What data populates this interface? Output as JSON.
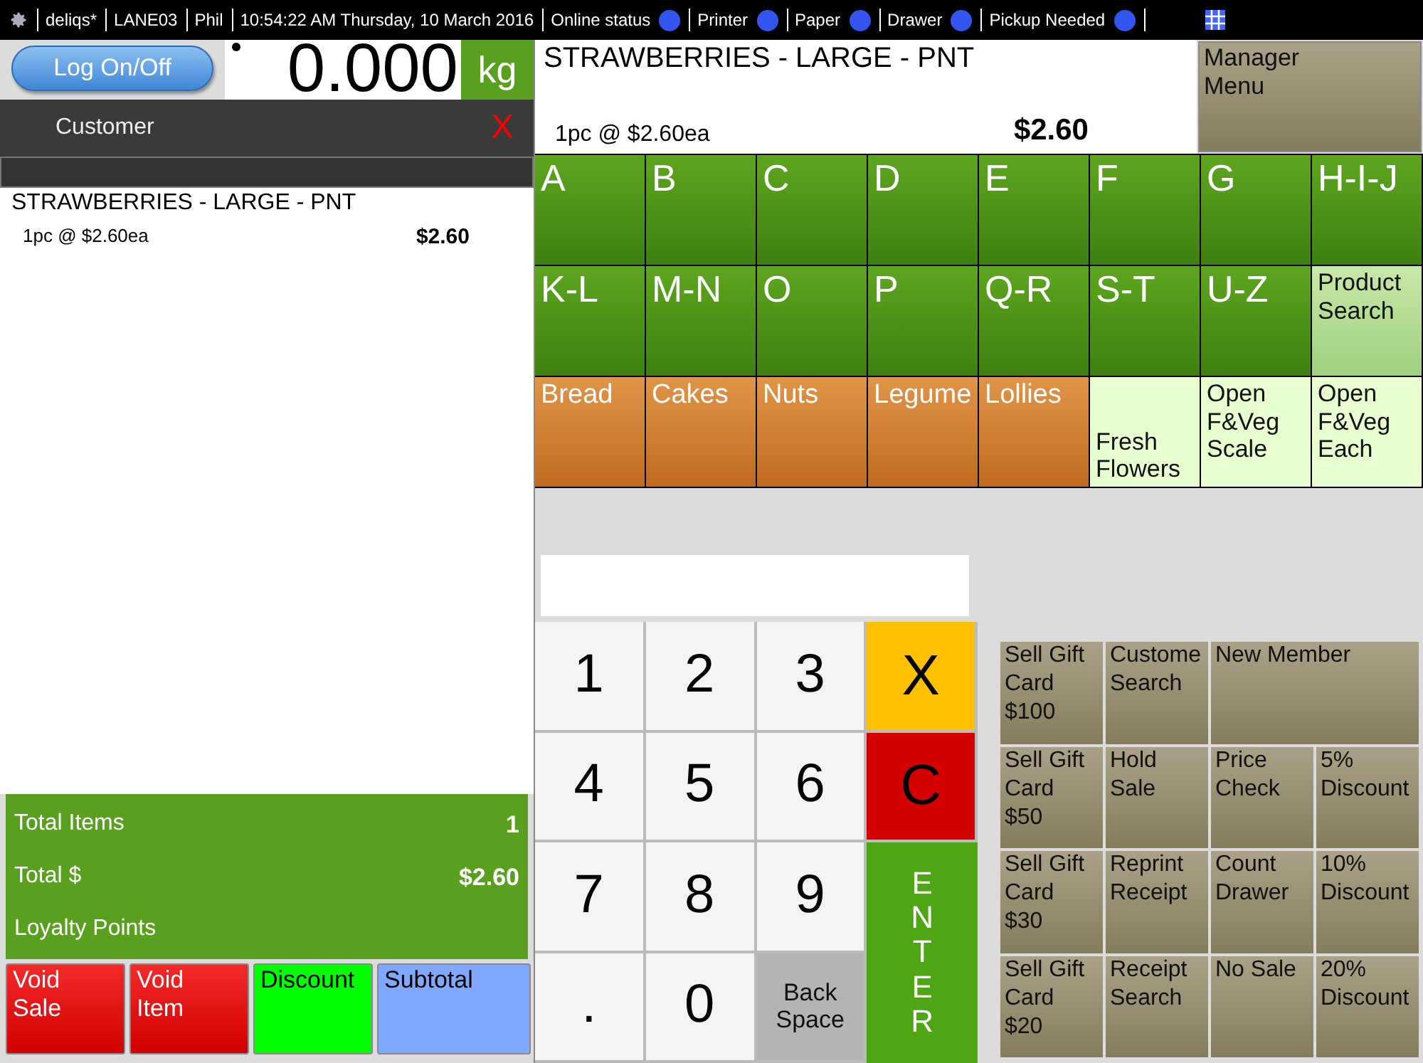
{
  "status_bar": {
    "items": [
      {
        "label": "deliqs*"
      },
      {
        "label": "LANE03"
      },
      {
        "label": "Phil"
      },
      {
        "label": "10:54:22 AM Thursday, 10 March 2016"
      }
    ],
    "indicators": [
      {
        "label": "Online status",
        "color": "#3355ee"
      },
      {
        "label": "Printer",
        "color": "#3355ee"
      },
      {
        "label": "Paper",
        "color": "#3355ee"
      },
      {
        "label": "Drawer",
        "color": "#3355ee"
      },
      {
        "label": "Pickup Needed",
        "color": "#3355ee"
      }
    ]
  },
  "login_button": "Log On/Off",
  "scale": {
    "value": "0.000",
    "unit": "kg"
  },
  "customer": {
    "label": "Customer",
    "clear": "X"
  },
  "sale_items": [
    {
      "name": "STRAWBERRIES - LARGE - PNT",
      "detail": "1pc @ $2.60ea",
      "price": "$2.60"
    }
  ],
  "totals": [
    {
      "label": "Total Items",
      "value": "1"
    },
    {
      "label": "Total $",
      "value": "$2.60"
    },
    {
      "label": "Loyalty Points"
    }
  ],
  "sale_actions": [
    {
      "label": "Void\nSale",
      "kind": "void"
    },
    {
      "label": "Void\nItem",
      "kind": "void"
    },
    {
      "label": "Discount",
      "kind": "discount"
    },
    {
      "label": "Subtotal",
      "kind": "subtotal"
    }
  ],
  "current_item": {
    "name": "STRAWBERRIES - LARGE - PNT",
    "detail": "1pc @ $2.60ea",
    "price": "$2.60"
  },
  "manager_menu": "Manager\nMenu",
  "categories": [
    {
      "label": "A",
      "kind": "letter"
    },
    {
      "label": "B",
      "kind": "letter"
    },
    {
      "label": "C",
      "kind": "letter"
    },
    {
      "label": "D",
      "kind": "letter"
    },
    {
      "label": "E",
      "kind": "letter"
    },
    {
      "label": "F",
      "kind": "letter"
    },
    {
      "label": "G",
      "kind": "letter"
    },
    {
      "label": "H-I-J",
      "kind": "letter"
    },
    {
      "label": "K-L",
      "kind": "letter"
    },
    {
      "label": "M-N",
      "kind": "letter"
    },
    {
      "label": "O",
      "kind": "letter"
    },
    {
      "label": "P",
      "kind": "letter"
    },
    {
      "label": "Q-R",
      "kind": "letter"
    },
    {
      "label": "S-T",
      "kind": "letter"
    },
    {
      "label": "U-Z",
      "kind": "letter"
    },
    {
      "label": "Product\nSearch",
      "kind": "search"
    },
    {
      "label": "Bread",
      "kind": "group"
    },
    {
      "label": "Cakes",
      "kind": "group"
    },
    {
      "label": "Nuts",
      "kind": "group"
    },
    {
      "label": "Legume",
      "kind": "group"
    },
    {
      "label": "Lollies",
      "kind": "group"
    },
    {
      "label": "Fresh\nFlowers",
      "kind": "flowers"
    },
    {
      "label": "Open\nF&Veg\nScale",
      "kind": "open"
    },
    {
      "label": "Open\nF&Veg\nEach",
      "kind": "open"
    }
  ],
  "keypad": [
    {
      "label": "1",
      "kind": "digit"
    },
    {
      "label": "2",
      "kind": "digit"
    },
    {
      "label": "3",
      "kind": "digit"
    },
    {
      "label": "X",
      "kind": "cancel"
    },
    {
      "label": "4",
      "kind": "digit"
    },
    {
      "label": "5",
      "kind": "digit"
    },
    {
      "label": "6",
      "kind": "digit"
    },
    {
      "label": "C",
      "kind": "clear"
    },
    {
      "label": "7",
      "kind": "digit"
    },
    {
      "label": "8",
      "kind": "digit"
    },
    {
      "label": "9",
      "kind": "digit"
    },
    {
      "label": ".",
      "kind": "digit"
    },
    {
      "label": "0",
      "kind": "digit"
    },
    {
      "label": "Back\nSpace",
      "kind": "backspace"
    },
    {
      "label": "ENTER",
      "kind": "enter"
    }
  ],
  "functions": [
    {
      "label": "Sell Gift\nCard\n$100",
      "kind": "single"
    },
    {
      "label": "Custome\nSearch",
      "kind": "single"
    },
    {
      "label": "New Member",
      "kind": "wide"
    },
    {
      "label": "Sell Gift\nCard\n$50",
      "kind": "single"
    },
    {
      "label": "Hold\nSale",
      "kind": "single"
    },
    {
      "label": "Price\nCheck",
      "kind": "single"
    },
    {
      "label": "5%\nDiscount",
      "kind": "single"
    },
    {
      "label": "Sell Gift\nCard\n$30",
      "kind": "single"
    },
    {
      "label": "Reprint\nReceipt",
      "kind": "single"
    },
    {
      "label": "Count\nDrawer",
      "kind": "single"
    },
    {
      "label": "10%\nDiscount",
      "kind": "single"
    },
    {
      "label": "Sell Gift\nCard\n$20",
      "kind": "single"
    },
    {
      "label": "Receipt\nSearch",
      "kind": "single"
    },
    {
      "label": "No Sale",
      "kind": "single"
    },
    {
      "label": "20%\nDiscount",
      "kind": "single"
    }
  ]
}
